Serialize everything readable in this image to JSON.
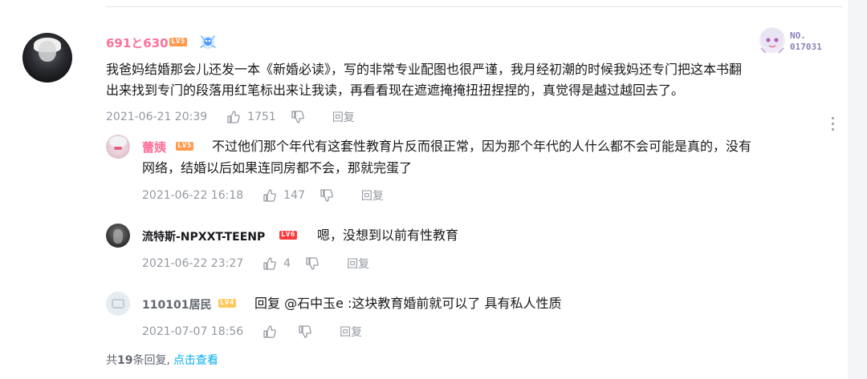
{
  "main_comment": {
    "username": "691と630",
    "level": "LV5",
    "text_line1": "我爸妈结婚那会儿还发一本《新婚必读》，写的非常专业配图也很严谨，我月经初潮的时候我妈还专门把这本书翻",
    "text_line2": "出来找到专门的段落用红笔标出来让我读，再看看现在遮遮掩掩扭扭捏捏的，真觉得是越过越回去了。",
    "date": "2021-06-21 20:39",
    "likes": "1751",
    "reply_label": "回复",
    "badge_no": "NO.",
    "badge_number": "017031"
  },
  "replies": [
    {
      "username": "蕾姨",
      "level": "LV5",
      "text_line1": "不过他们那个年代有这套性教育片反而很正常，因为那个年代的人什么都不会可能是真的，没有",
      "text_line2": "网络，结婚以后如果连同房都不会，那就完蛋了",
      "date": "2021-06-22 16:18",
      "likes": "147",
      "reply_label": "回复"
    },
    {
      "username": "流特斯-NPXXT-TEENP",
      "level": "LV6",
      "text": "嗯，没想到以前有性教育",
      "date": "2021-06-22 23:27",
      "likes": "4",
      "reply_label": "回复"
    },
    {
      "username": "110101居民",
      "level": "LV4",
      "text": "回复 @石中玉e :这块教育婚前就可以了 具有私人性质",
      "date": "2021-07-07 18:56",
      "likes": "",
      "reply_label": "回复"
    }
  ],
  "footer": {
    "prefix": "共",
    "count": "19",
    "suffix": "条回复,",
    "link": "点击查看"
  },
  "colors": {
    "username_pink": "#fb7299",
    "meta_gray": "#9499a0",
    "link_blue": "#00aeec"
  }
}
